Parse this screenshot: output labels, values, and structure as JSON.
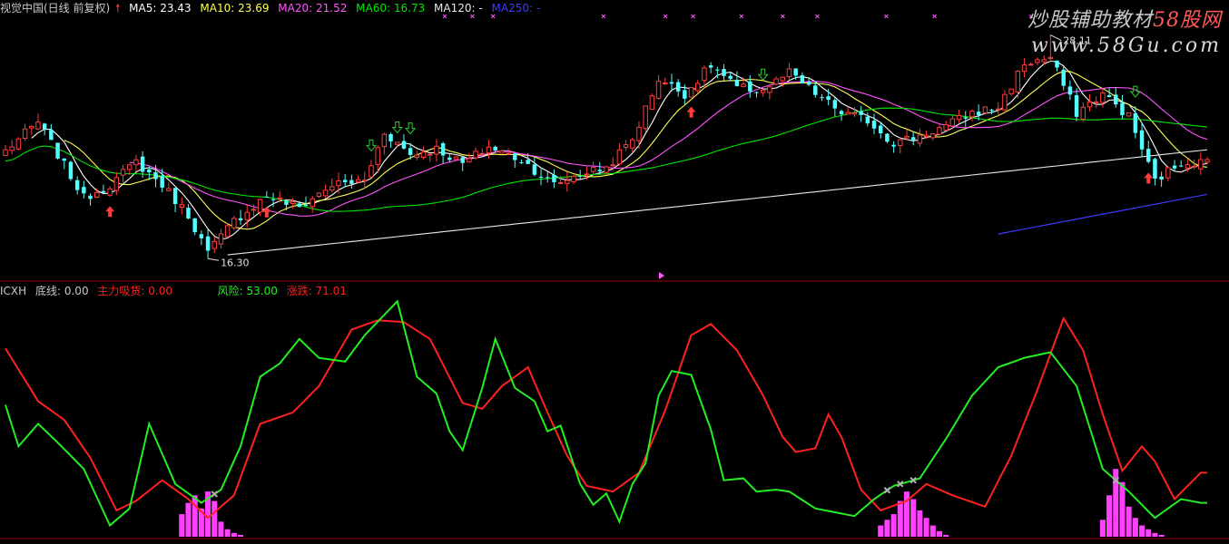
{
  "main_legend": {
    "title": "视觉中国(日线 前复权)",
    "ma5": "MA5: 23.43",
    "ma10": "MA10: 23.69",
    "ma20": "MA20: 21.52",
    "ma60": "MA60: 16.73",
    "ma120": "MA120: -",
    "ma250": "MA250: -"
  },
  "indicator_legend": {
    "name": "ICXH",
    "baseline": "底线: 0.00",
    "main_force": "主力吸货: 0.00",
    "risk": "风险: 53.00",
    "rise_fall": "涨跌: 71.01"
  },
  "watermark": {
    "line1_prefix": "炒股辅助教材",
    "line1_brand": "58股网",
    "line2": "www.58Gu.com"
  },
  "colors": {
    "up": "#ff3c3c",
    "down": "#54ffff",
    "ma5": "#ffffff",
    "ma10": "#ffff54",
    "ma20": "#ff54ff",
    "ma60": "#00e600",
    "ma120": "#e8e8e8",
    "ma250": "#3a3aff",
    "fast_line": "#22ee22",
    "slow_line": "#ff2020",
    "bars": "#ff40ff",
    "axis": "#a00000"
  },
  "chart_data": [
    {
      "type": "candlestick",
      "title": "视觉中国(日线 前复权)",
      "series_names": [
        "MA5",
        "MA10",
        "MA20",
        "MA60",
        "MA120",
        "MA250"
      ],
      "ylim": [
        15.5,
        29.0
      ],
      "annotations": [
        {
          "text": "28.11",
          "value": 28.11
        },
        {
          "text": "16.30",
          "value": 16.3
        }
      ],
      "anchors": [
        [
          0,
          22.0
        ],
        [
          5,
          23.5
        ],
        [
          8,
          21.8
        ],
        [
          12,
          19.5
        ],
        [
          16,
          20.2
        ],
        [
          20,
          21.4
        ],
        [
          24,
          20.2
        ],
        [
          28,
          18.6
        ],
        [
          31,
          16.6
        ],
        [
          35,
          18.3
        ],
        [
          40,
          19.6
        ],
        [
          45,
          19.0
        ],
        [
          50,
          20.2
        ],
        [
          55,
          20.4
        ],
        [
          58,
          23.0
        ],
        [
          62,
          21.8
        ],
        [
          66,
          22.1
        ],
        [
          70,
          21.3
        ],
        [
          74,
          22.2
        ],
        [
          79,
          21.5
        ],
        [
          84,
          20.2
        ],
        [
          88,
          20.8
        ],
        [
          92,
          21.1
        ],
        [
          96,
          22.6
        ],
        [
          100,
          25.8
        ],
        [
          104,
          25.0
        ],
        [
          108,
          26.5
        ],
        [
          112,
          25.3
        ],
        [
          116,
          25.2
        ],
        [
          120,
          26.1
        ],
        [
          124,
          25.0
        ],
        [
          128,
          24.0
        ],
        [
          132,
          23.6
        ],
        [
          136,
          22.4
        ],
        [
          140,
          22.8
        ],
        [
          144,
          23.3
        ],
        [
          148,
          24.0
        ],
        [
          152,
          24.3
        ],
        [
          156,
          26.6
        ],
        [
          160,
          26.9
        ],
        [
          164,
          24.0
        ],
        [
          168,
          25.0
        ],
        [
          172,
          23.8
        ],
        [
          176,
          20.4
        ],
        [
          180,
          21.4
        ],
        [
          184,
          21.4
        ]
      ],
      "ma_lengths": [
        5,
        10,
        20,
        60,
        120,
        250
      ]
    },
    {
      "type": "line",
      "title": "ICXH",
      "series": [
        {
          "name": "风险",
          "anchors": [
            [
              0,
              70
            ],
            [
              2,
              48
            ],
            [
              5,
              60
            ],
            [
              8,
              50
            ],
            [
              12,
              36
            ],
            [
              16,
              6
            ],
            [
              19,
              15
            ],
            [
              22,
              60
            ],
            [
              26,
              28
            ],
            [
              30,
              18
            ],
            [
              33,
              25
            ],
            [
              36,
              48
            ],
            [
              39,
              85
            ],
            [
              42,
              92
            ],
            [
              45,
              105
            ],
            [
              48,
              95
            ],
            [
              52,
              93
            ],
            [
              55,
              107
            ],
            [
              60,
              125
            ],
            [
              63,
              85
            ],
            [
              66,
              76
            ],
            [
              68,
              56
            ],
            [
              70,
              46
            ],
            [
              73,
              79
            ],
            [
              75,
              105
            ],
            [
              78,
              79
            ],
            [
              81,
              72
            ],
            [
              83,
              56
            ],
            [
              85,
              59
            ],
            [
              88,
              28
            ],
            [
              90,
              17
            ],
            [
              92,
              23
            ],
            [
              94,
              8
            ],
            [
              96,
              28
            ],
            [
              98,
              39
            ],
            [
              100,
              75
            ],
            [
              102,
              88
            ],
            [
              105,
              86
            ],
            [
              108,
              57
            ],
            [
              110,
              30
            ],
            [
              113,
              31
            ],
            [
              115,
              24
            ],
            [
              118,
              25
            ],
            [
              120,
              24
            ],
            [
              124,
              15
            ],
            [
              127,
              13
            ],
            [
              130,
              11
            ],
            [
              133,
              20
            ],
            [
              136,
              27
            ],
            [
              140,
              31
            ],
            [
              144,
              52
            ],
            [
              148,
              75
            ],
            [
              152,
              90
            ],
            [
              156,
              95
            ],
            [
              160,
              98
            ],
            [
              164,
              80
            ],
            [
              166,
              58
            ],
            [
              168,
              36
            ],
            [
              172,
              24
            ],
            [
              176,
              10
            ],
            [
              180,
              20
            ],
            [
              183,
              18
            ]
          ]
        },
        {
          "name": "涨跌",
          "anchors": [
            [
              0,
              100
            ],
            [
              5,
              72
            ],
            [
              9,
              62
            ],
            [
              13,
              42
            ],
            [
              17,
              14
            ],
            [
              20,
              19
            ],
            [
              24,
              30
            ],
            [
              28,
              20
            ],
            [
              31,
              10
            ],
            [
              35,
              22
            ],
            [
              39,
              60
            ],
            [
              44,
              66
            ],
            [
              48,
              80
            ],
            [
              53,
              110
            ],
            [
              57,
              115
            ],
            [
              61,
              114
            ],
            [
              65,
              105
            ],
            [
              70,
              71
            ],
            [
              73,
              68
            ],
            [
              76,
              80
            ],
            [
              80,
              90
            ],
            [
              83,
              66
            ],
            [
              86,
              43
            ],
            [
              89,
              27
            ],
            [
              93,
              24
            ],
            [
              97,
              34
            ],
            [
              101,
              67
            ],
            [
              105,
              107
            ],
            [
              108,
              113
            ],
            [
              112,
              99
            ],
            [
              116,
              75
            ],
            [
              119,
              53
            ],
            [
              121,
              45
            ],
            [
              124,
              47
            ],
            [
              126,
              65
            ],
            [
              128,
              53
            ],
            [
              131,
              25
            ],
            [
              134,
              14
            ],
            [
              138,
              19
            ],
            [
              141,
              28
            ],
            [
              145,
              22
            ],
            [
              150,
              16
            ],
            [
              154,
              43
            ],
            [
              158,
              78
            ],
            [
              162,
              116
            ],
            [
              165,
              99
            ],
            [
              168,
              65
            ],
            [
              171,
              35
            ],
            [
              174,
              48
            ],
            [
              176,
              40
            ],
            [
              179,
              20
            ],
            [
              183,
              34
            ]
          ]
        },
        {
          "name": "主力吸货",
          "type": "bar",
          "anchors": [
            [
              26,
              0
            ],
            [
              27,
              12
            ],
            [
              28,
              18
            ],
            [
              29,
              22
            ],
            [
              30,
              15
            ],
            [
              31,
              24
            ],
            [
              32,
              19
            ],
            [
              33,
              8
            ],
            [
              34,
              4
            ],
            [
              35,
              2
            ],
            [
              36,
              1
            ],
            [
              37,
              0
            ],
            [
              133,
              0
            ],
            [
              134,
              6
            ],
            [
              135,
              9
            ],
            [
              136,
              12
            ],
            [
              137,
              19
            ],
            [
              138,
              24
            ],
            [
              139,
              20
            ],
            [
              140,
              14
            ],
            [
              141,
              10
            ],
            [
              142,
              6
            ],
            [
              143,
              3
            ],
            [
              144,
              1
            ],
            [
              145,
              0
            ],
            [
              167,
              0
            ],
            [
              168,
              9
            ],
            [
              169,
              22
            ],
            [
              170,
              36
            ],
            [
              171,
              29
            ],
            [
              172,
              16
            ],
            [
              173,
              10
            ],
            [
              174,
              6
            ],
            [
              175,
              4
            ],
            [
              176,
              2
            ],
            [
              177,
              1
            ],
            [
              178,
              0
            ]
          ]
        }
      ],
      "ylim": [
        0,
        130
      ]
    }
  ]
}
